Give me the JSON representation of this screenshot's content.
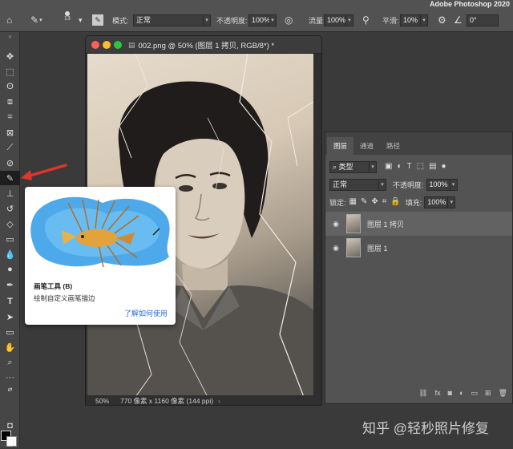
{
  "app_title": "Adobe Photoshop 2020",
  "options_bar": {
    "brush_size": "13",
    "mode_label": "模式:",
    "mode_value": "正常",
    "opacity_label": "不透明度:",
    "opacity_value": "100%",
    "flow_label": "流量:",
    "flow_value": "100%",
    "smoothing_label": "平滑:",
    "smoothing_value": "10%",
    "angle_value": "0°"
  },
  "document": {
    "title": "002.png @ 50% (图层 1 拷贝, RGB/8*) *",
    "zoom": "50%",
    "info": "770 像素 x 1160 像素 (144 ppi)"
  },
  "tooltip": {
    "title": "画笔工具 (B)",
    "description": "绘制自定义画笔描边",
    "link": "了解如何使用"
  },
  "layers_panel": {
    "tabs": [
      "图层",
      "通道",
      "路径"
    ],
    "filter_label": "类型",
    "blend_mode": "正常",
    "opacity_label": "不透明度:",
    "opacity_value": "100%",
    "lock_label": "锁定:",
    "fill_label": "填充:",
    "fill_value": "100%",
    "layers": [
      {
        "name": "图层 1 拷贝",
        "selected": true
      },
      {
        "name": "图层 1",
        "selected": false
      }
    ]
  },
  "watermark": "知乎 @轻秒照片修复",
  "colors": {
    "accent_arrow": "#e0352b",
    "link": "#2a6ed6",
    "brush_splash": "#3aa0e8"
  }
}
